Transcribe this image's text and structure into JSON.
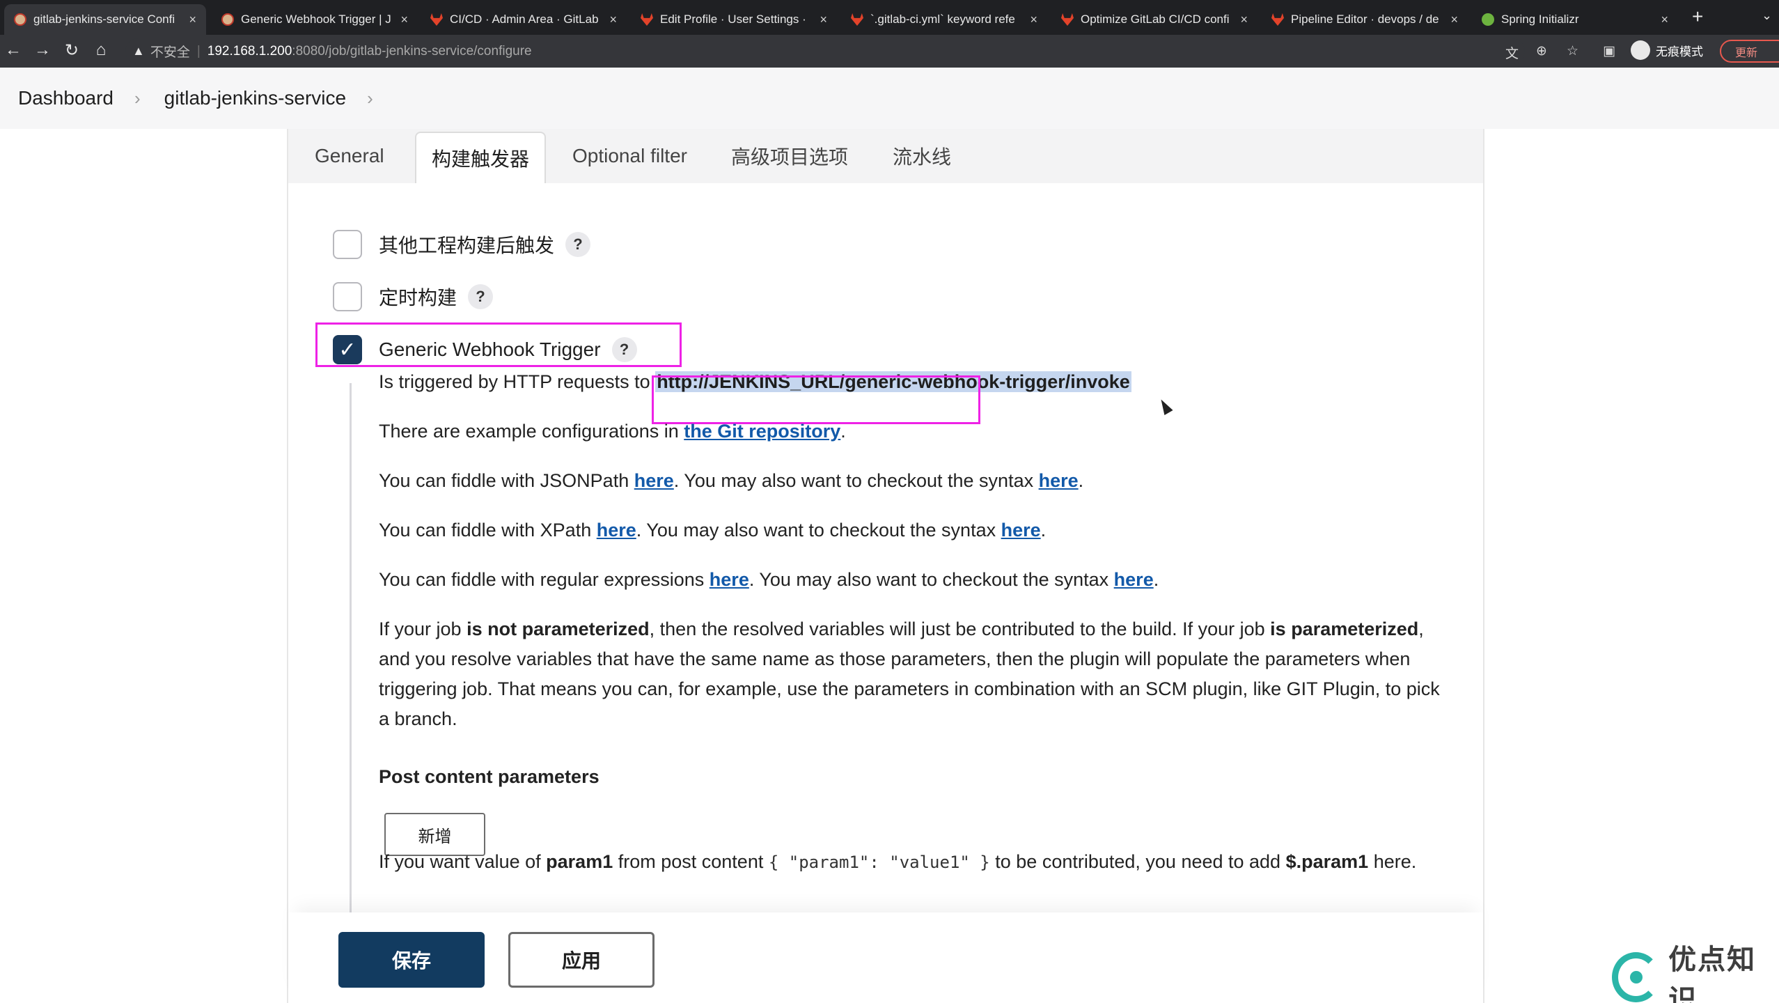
{
  "browser": {
    "tabs": [
      {
        "title": "gitlab-jenkins-service Confi",
        "favicon": "jenkins-icon",
        "active": true
      },
      {
        "title": "Generic Webhook Trigger | J",
        "favicon": "jenkins-icon",
        "active": false
      },
      {
        "title": "CI/CD · Admin Area · GitLab",
        "favicon": "gitlab-icon",
        "active": false
      },
      {
        "title": "Edit Profile · User Settings ·",
        "favicon": "gitlab-icon",
        "active": false
      },
      {
        "title": "`.gitlab-ci.yml` keyword refe",
        "favicon": "gitlab-icon",
        "active": false
      },
      {
        "title": "Optimize GitLab CI/CD confi",
        "favicon": "gitlab-icon",
        "active": false
      },
      {
        "title": "Pipeline Editor · devops / de",
        "favicon": "gitlab-icon",
        "active": false
      },
      {
        "title": "Spring Initializr",
        "favicon": "spring-icon",
        "active": false
      }
    ],
    "security_label": "不安全",
    "url_host": "192.168.1.200",
    "url_path": ":8080/job/gitlab-jenkins-service/configure",
    "incognito_label": "无痕模式",
    "update_label": "更新"
  },
  "breadcrumb": {
    "items": [
      "Dashboard",
      "gitlab-jenkins-service"
    ]
  },
  "config_tabs": [
    "General",
    "构建触发器",
    "Optional filter",
    "高级项目选项",
    "流水线"
  ],
  "active_tab": "构建触发器",
  "triggers": [
    {
      "label": "其他工程构建后触发",
      "checked": false
    },
    {
      "label": "定时构建",
      "checked": false
    },
    {
      "label": "Generic Webhook Trigger",
      "checked": true
    }
  ],
  "help_label": "?",
  "webhook": {
    "triggered_prefix": "Is triggered by HTTP requests to",
    "invoke_url": "http://JENKINS_URL/generic-webhook-trigger/invoke",
    "examples_prefix": "There are example configurations in",
    "examples_link": "the Git repository",
    "period": ".",
    "jsonpath_prefix": "You can fiddle with JSONPath",
    "xpath_prefix": "You can fiddle with XPath",
    "regex_prefix": "You can fiddle with regular expressions",
    "here": "here",
    "syntax_mid": ". You may also want to checkout the syntax",
    "param_p1": "If your job",
    "param_b1": "is not parameterized",
    "param_p2": ", then the resolved variables will just be contributed to the build. If your job",
    "param_b2": "is parameterized",
    "param_p3": ", and you resolve variables that have the same name as those parameters, then the plugin will populate the parameters when triggering job. That means you can, for example, use the parameters in combination with an SCM plugin, like GIT Plugin, to pick a branch.",
    "post_content_heading": "Post content parameters",
    "add_button": "新增",
    "post_hint_p1": "If you want value of",
    "post_hint_b1": "param1",
    "post_hint_p2": "from post content",
    "post_hint_code": "{ \"param1\": \"value1\" }",
    "post_hint_p3": "to be contributed, you need to add",
    "post_hint_b2": "$.param1",
    "post_hint_p4": "here."
  },
  "actions": {
    "save": "保存",
    "apply": "应用"
  },
  "watermark": "优点知识",
  "colors": {
    "accent": "#123b60",
    "link": "#1259a9",
    "highlight": "#ee22e6"
  }
}
